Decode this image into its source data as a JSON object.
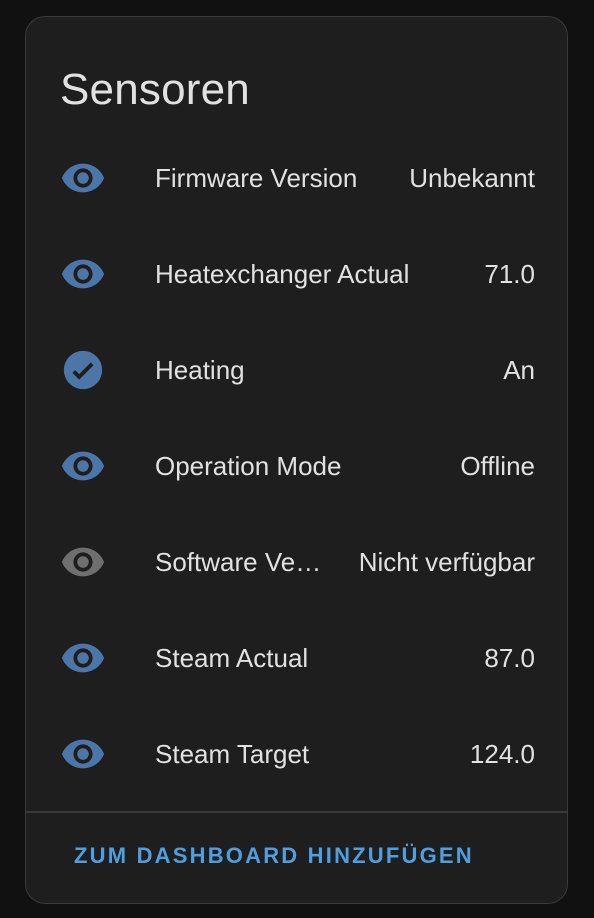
{
  "card": {
    "title": "Sensoren",
    "action_label": "ZUM DASHBOARD HINZUFÜGEN"
  },
  "colors": {
    "icon_active": "#4c76a8",
    "icon_unavailable": "#6f6f6f",
    "accent": "#4f9fe0",
    "card_bg": "#1e1e1e",
    "page_bg": "#111111"
  },
  "entities": [
    {
      "name": "Firmware Version",
      "state": "Unbekannt",
      "icon": "eye-icon",
      "available": true
    },
    {
      "name": "Heatexchanger Actual",
      "state": "71.0",
      "icon": "eye-icon",
      "available": true
    },
    {
      "name": "Heating",
      "state": "An",
      "icon": "check-circle-icon",
      "available": true
    },
    {
      "name": "Operation Mode",
      "state": "Offline",
      "icon": "eye-icon",
      "available": true
    },
    {
      "name": "Software Ve…",
      "state": "Nicht verfügbar",
      "icon": "eye-icon",
      "available": false
    },
    {
      "name": "Steam Actual",
      "state": "87.0",
      "icon": "eye-icon",
      "available": true
    },
    {
      "name": "Steam Target",
      "state": "124.0",
      "icon": "eye-icon",
      "available": true
    }
  ]
}
